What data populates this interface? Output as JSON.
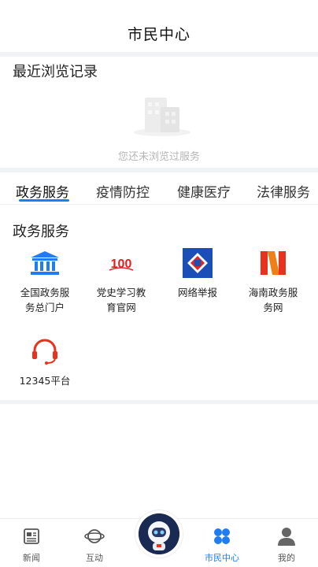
{
  "header": {
    "title": "市民中心"
  },
  "recent": {
    "title": "最近浏览记录",
    "empty_text": "您还未浏览过服务"
  },
  "tabs": [
    {
      "label": "政务服务",
      "active": true
    },
    {
      "label": "疫情防控",
      "active": false
    },
    {
      "label": "健康医疗",
      "active": false
    },
    {
      "label": "法律服务",
      "active": false
    }
  ],
  "service_section": {
    "title": "政务服务",
    "items": [
      {
        "label_line1": "全国政务服",
        "label_line2": "务总门户",
        "icon": "government-building-icon"
      },
      {
        "label_line1": "党史学习教",
        "label_line2": "育官网",
        "icon": "party-history-100-icon"
      },
      {
        "label_line1": "网络举报",
        "label_line2": "",
        "icon": "report-logo-icon"
      },
      {
        "label_line1": "海南政务服",
        "label_line2": "务网",
        "icon": "hainan-logo-icon"
      },
      {
        "label_line1": "12345平台",
        "label_line2": "",
        "icon": "hotline-headset-icon"
      }
    ]
  },
  "bottom_nav": [
    {
      "label": "新闻",
      "icon": "news-icon",
      "active": false
    },
    {
      "label": "互动",
      "icon": "planet-icon",
      "active": false
    },
    {
      "label": "",
      "icon": "astronaut-mascot-icon",
      "active": false
    },
    {
      "label": "市民中心",
      "icon": "grid-clover-icon",
      "active": true
    },
    {
      "label": "我的",
      "icon": "user-icon",
      "active": false
    }
  ],
  "colors": {
    "accent": "#1f7cf2",
    "divider": "#f1f2f6"
  }
}
